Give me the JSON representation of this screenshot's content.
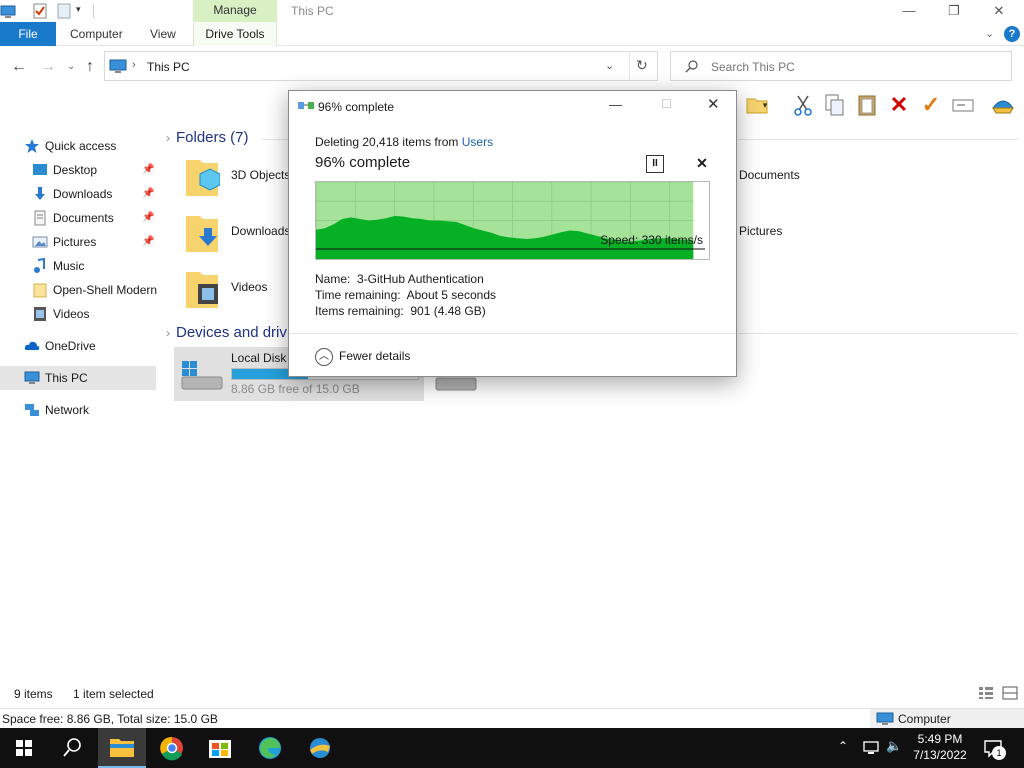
{
  "window": {
    "title": "This PC",
    "manage_tab": "Manage",
    "controls": [
      "minimize-icon",
      "maximize-icon",
      "close-icon"
    ]
  },
  "ribbon": {
    "tabs": [
      {
        "label": "File"
      },
      {
        "label": "Computer"
      },
      {
        "label": "View"
      },
      {
        "label": "Drive Tools"
      }
    ]
  },
  "address": {
    "path": "This PC",
    "search_placeholder": "Search This PC"
  },
  "navpane": {
    "items": [
      {
        "label": "Quick access",
        "icon": "star-icon"
      },
      {
        "label": "Desktop",
        "icon": "desktop-icon",
        "pinned": true
      },
      {
        "label": "Downloads",
        "icon": "downloads-icon",
        "pinned": true
      },
      {
        "label": "Documents",
        "icon": "documents-icon",
        "pinned": true
      },
      {
        "label": "Pictures",
        "icon": "pictures-icon",
        "pinned": true
      },
      {
        "label": "Music",
        "icon": "music-icon"
      },
      {
        "label": "Open-Shell Modern",
        "icon": "folder-icon"
      },
      {
        "label": "Videos",
        "icon": "videos-icon"
      },
      {
        "label": "OneDrive",
        "icon": "cloud-icon"
      },
      {
        "label": "This PC",
        "icon": "computer-icon"
      },
      {
        "label": "Network",
        "icon": "network-icon"
      }
    ]
  },
  "content": {
    "folders_header": "Folders (7)",
    "devices_header": "Devices and driv",
    "folders": [
      {
        "label": "3D Objects"
      },
      {
        "label": "Downloads"
      },
      {
        "label": "Videos"
      },
      {
        "label": "Documents"
      },
      {
        "label": "Pictures"
      }
    ],
    "drive": {
      "name": "Local Disk",
      "free_text": "8.86 GB free of 15.0 GB",
      "used_fraction": 0.41
    }
  },
  "statusbar": {
    "items_count": "9 items",
    "selected": "1 item selected",
    "space": "Space free: 8.86 GB, Total size: 15.0 GB",
    "computer": "Computer"
  },
  "dialog": {
    "title": "96% complete",
    "deleting_prefix": "Deleting 20,418 items from",
    "deleting_source": "Users",
    "percent_text": "96% complete",
    "speed": "Speed: 330 items/s",
    "name_label": "Name:",
    "name_value": "3-GitHub Authentication",
    "time_label": "Time remaining:",
    "time_value": "About 5 seconds",
    "items_label": "Items remaining:",
    "items_value": "901 (4.48 GB)",
    "fewer_details": "Fewer details",
    "progress_fraction": 0.96
  },
  "taskbar": {
    "time": "5:49 PM",
    "date": "7/13/2022",
    "notification_count": "1"
  },
  "chart_data": {
    "type": "area",
    "title": "",
    "xlabel": "",
    "ylabel": "",
    "values": [
      0.38,
      0.4,
      0.45,
      0.52,
      0.54,
      0.52,
      0.5,
      0.51,
      0.53,
      0.56,
      0.55,
      0.53,
      0.52,
      0.5,
      0.5,
      0.49,
      0.48,
      0.44,
      0.4,
      0.37,
      0.34,
      0.3,
      0.28,
      0.27,
      0.26,
      0.27,
      0.29,
      0.32,
      0.35,
      0.37,
      0.36,
      0.33,
      0.3,
      0.27,
      0.25,
      0.23,
      0.23,
      0.24,
      0.26,
      0.27,
      0.27,
      0.26,
      0.25,
      0.24
    ],
    "ylim": [
      0,
      1
    ],
    "progress_fraction": 0.96
  },
  "colors": {
    "accent": "#1979ca",
    "chart_bg": "#a6e39a",
    "chart_fill": "#06b025",
    "manage_tab": "#d8f0c4"
  }
}
